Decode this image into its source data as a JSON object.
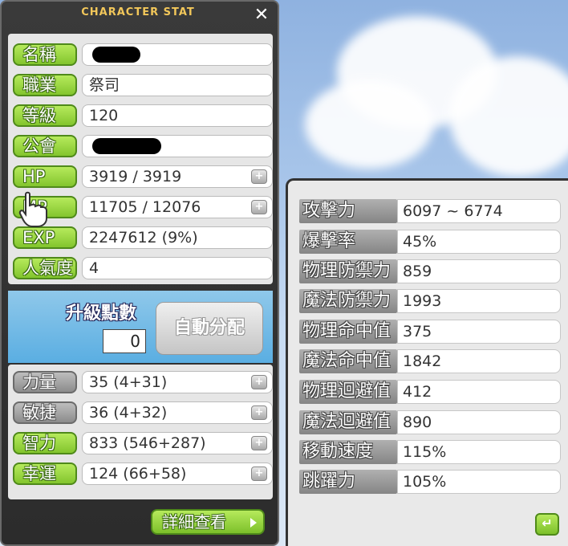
{
  "window": {
    "title": "CHARACTER STAT",
    "close_icon": "close-icon"
  },
  "basic": [
    {
      "label": "名稱",
      "value": "",
      "redacted": true
    },
    {
      "label": "職業",
      "value": "祭司"
    },
    {
      "label": "等級",
      "value": "120"
    },
    {
      "label": "公會",
      "value": "",
      "redacted": true
    },
    {
      "label": "HP",
      "value": "3919 / 3919",
      "has_plus": true
    },
    {
      "label": "MP",
      "value": "11705 / 12076",
      "has_plus": true
    },
    {
      "label": "EXP",
      "value": "2247612 (9%)"
    },
    {
      "label": "人氣度",
      "value": "4"
    }
  ],
  "ability_points": {
    "label": "升級點數",
    "value": "0",
    "auto_button": "自動分配"
  },
  "stats": [
    {
      "label": "力量",
      "value": "35 (4+31)",
      "style": "gray"
    },
    {
      "label": "敏捷",
      "value": "36 (4+32)",
      "style": "gray"
    },
    {
      "label": "智力",
      "value": "833 (546+287)",
      "style": "green"
    },
    {
      "label": "幸運",
      "value": "124 (66+58)",
      "style": "green"
    }
  ],
  "detail_button": "詳細查看",
  "detail": [
    {
      "label": "攻擊力",
      "value": "6097 ~ 6774"
    },
    {
      "label": "爆擊率",
      "value": "45%"
    },
    {
      "label": "物理防禦力",
      "value": "859"
    },
    {
      "label": "魔法防禦力",
      "value": "1993"
    },
    {
      "label": "物理命中值",
      "value": "375"
    },
    {
      "label": "魔法命中值",
      "value": "1842"
    },
    {
      "label": "物理迴避值",
      "value": "412"
    },
    {
      "label": "魔法迴避值",
      "value": "890"
    },
    {
      "label": "移動速度",
      "value": "115%"
    },
    {
      "label": "跳躍力",
      "value": "105%"
    }
  ],
  "icons": {
    "plus": "plus-icon",
    "back": "back-arrow-icon",
    "cursor": "hand-cursor-icon"
  },
  "colors": {
    "green_label": "#83c52d",
    "gray_label": "#8c8c8c",
    "title": "#f2c75a"
  }
}
